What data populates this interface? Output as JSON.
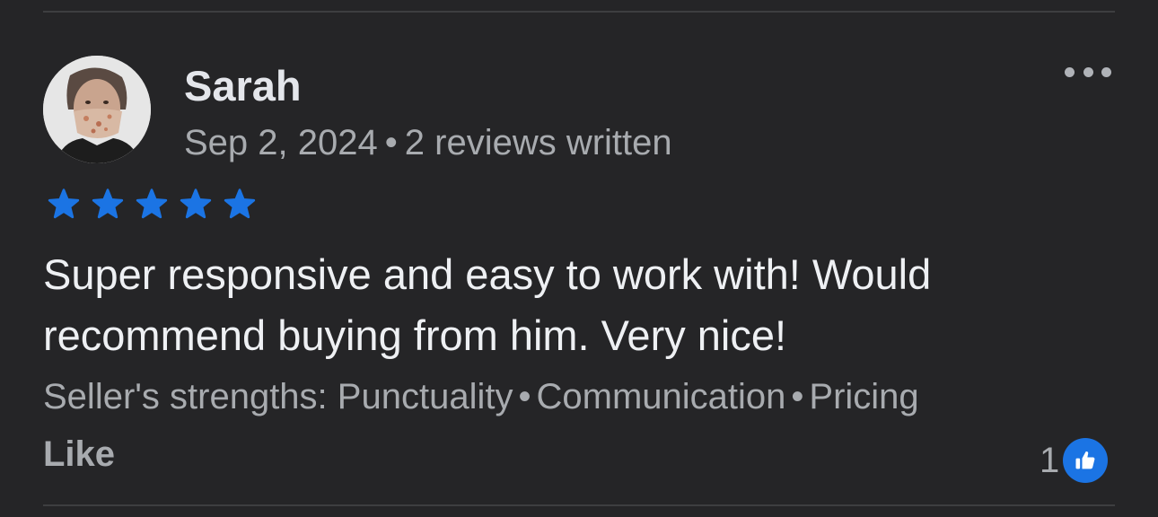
{
  "review": {
    "reviewer_name": "Sarah",
    "date": "Sep 2, 2024",
    "separator": "•",
    "review_count": "2 reviews written",
    "rating": 5,
    "rating_max": 5,
    "star_color": "#1b74e4",
    "text": "Super responsive and easy to work with! Would recommend buying from him. Very nice!",
    "strengths_label": "Seller's strengths:",
    "strengths": [
      "Punctuality",
      "Communication",
      "Pricing"
    ],
    "like_label": "Like",
    "like_count": "1"
  },
  "icons": {
    "more": "more-horizontal-icon",
    "star": "star-icon",
    "like": "thumbs-up-icon"
  }
}
